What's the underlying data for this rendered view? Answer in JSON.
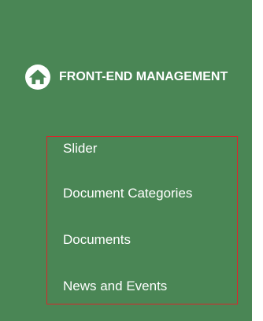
{
  "sidebar": {
    "section": {
      "icon": "home-icon",
      "label": "FRONT-END MANAGEMENT"
    },
    "items": [
      {
        "label": "Slider"
      },
      {
        "label": "Document Categories"
      },
      {
        "label": "Documents"
      },
      {
        "label": "News and Events"
      }
    ],
    "colors": {
      "background": "#4a8655",
      "text": "#ffffff",
      "highlight_border": "#d8272c"
    }
  }
}
